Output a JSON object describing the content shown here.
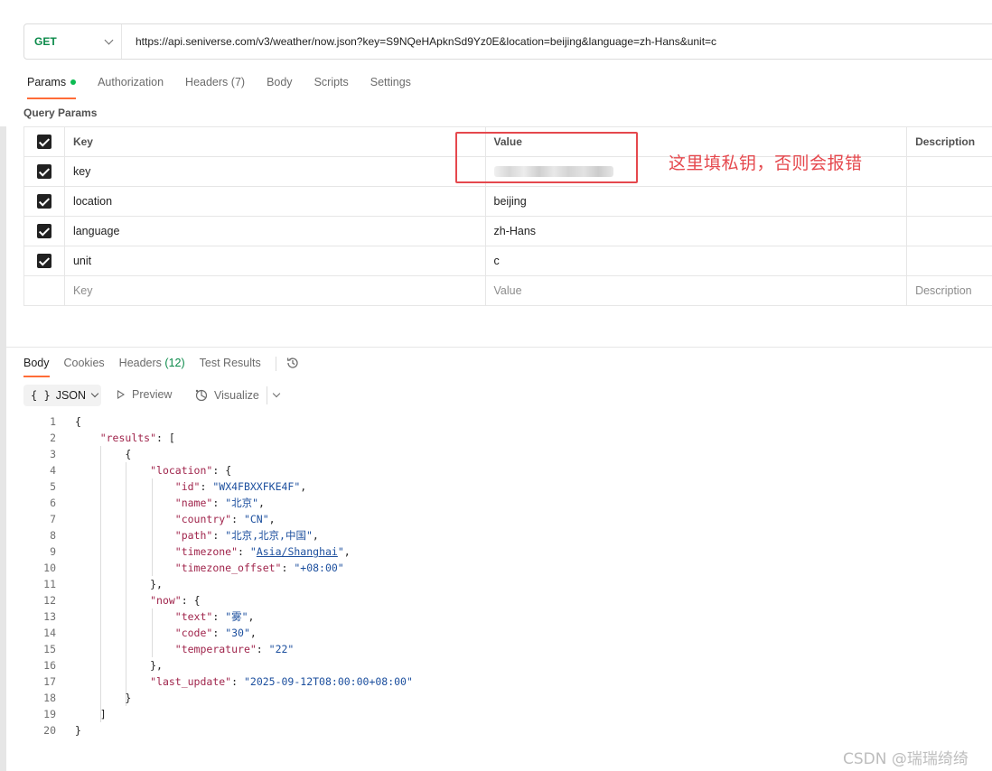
{
  "request": {
    "method": "GET",
    "url": "https://api.seniverse.com/v3/weather/now.json?key=S9NQeHApknSd9Yz0E&location=beijing&language=zh-Hans&unit=c"
  },
  "request_tabs": [
    {
      "label": "Params",
      "active": true
    },
    {
      "label": "Authorization"
    },
    {
      "label": "Headers",
      "count": "(7)"
    },
    {
      "label": "Body"
    },
    {
      "label": "Scripts"
    },
    {
      "label": "Settings"
    }
  ],
  "query_params": {
    "title": "Query Params",
    "headers": {
      "key": "Key",
      "value": "Value",
      "description": "Description"
    },
    "rows": [
      {
        "key": "key",
        "value": "",
        "checked": true
      },
      {
        "key": "location",
        "value": "beijing",
        "checked": true
      },
      {
        "key": "language",
        "value": "zh-Hans",
        "checked": true
      },
      {
        "key": "unit",
        "value": "c",
        "checked": true
      }
    ],
    "placeholder": {
      "key": "Key",
      "value": "Value",
      "description": "Description"
    }
  },
  "annotation": "这里填私钥，否则会报错",
  "response_tabs": [
    {
      "label": "Body",
      "active": true
    },
    {
      "label": "Cookies"
    },
    {
      "label": "Headers",
      "count": "(12)"
    },
    {
      "label": "Test Results"
    }
  ],
  "response_toolbar": {
    "format": "JSON",
    "format_icon": "{ }",
    "preview": "Preview",
    "visualize": "Visualize"
  },
  "response_body": {
    "line_numbers": [
      "1",
      "2",
      "3",
      "4",
      "5",
      "6",
      "7",
      "8",
      "9",
      "10",
      "11",
      "12",
      "13",
      "14",
      "15",
      "16",
      "17",
      "18",
      "19",
      "20"
    ],
    "results_key": "\"results\"",
    "location_key": "\"location\"",
    "location": [
      {
        "k": "\"id\"",
        "v": "\"WX4FBXXFKE4F\""
      },
      {
        "k": "\"name\"",
        "v": "\"北京\""
      },
      {
        "k": "\"country\"",
        "v": "\"CN\""
      },
      {
        "k": "\"path\"",
        "v": "\"北京,北京,中国\""
      }
    ],
    "timezone_k": "\"timezone\"",
    "timezone_open": "\"",
    "timezone_link": "Asia/Shanghai",
    "timezone_close": "\"",
    "tz_offset_k": "\"timezone_offset\"",
    "tz_offset_v": "\"+08:00\"",
    "now_key": "\"now\"",
    "now": [
      {
        "k": "\"text\"",
        "v": "\"雾\""
      },
      {
        "k": "\"code\"",
        "v": "\"30\""
      },
      {
        "k": "\"temperature\"",
        "v": "\"22\""
      }
    ],
    "last_update_k": "\"last_update\"",
    "last_update_v": "\"2025-09-12T08:00:00+08:00\""
  },
  "watermark": "CSDN @瑞瑞绮绮"
}
